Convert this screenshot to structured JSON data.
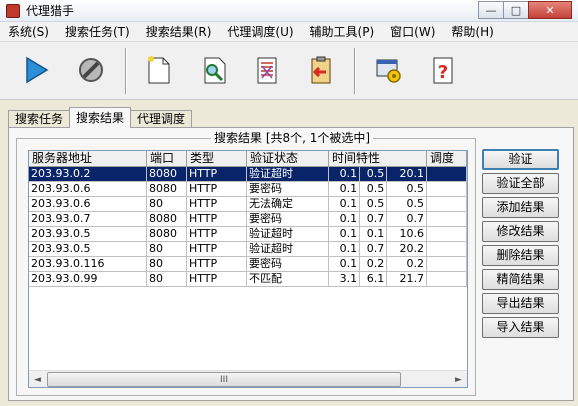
{
  "window": {
    "title": "代理猎手",
    "minimize": "—",
    "maximize": "□",
    "close": "✕"
  },
  "menu": [
    "系统(S)",
    "搜索任务(T)",
    "搜索结果(R)",
    "代理调度(U)",
    "辅助工具(P)",
    "窗口(W)",
    "帮助(H)"
  ],
  "toolbar": {
    "icons": [
      "play-icon",
      "stop-icon",
      "new-document-icon",
      "search-document-icon",
      "list-document-icon",
      "clipboard-import-icon",
      "settings-window-icon",
      "help-document-icon"
    ],
    "help_glyph": "?"
  },
  "tabs": [
    "搜索任务",
    "搜索结果",
    "代理调度"
  ],
  "group_title": "搜索结果 [共8个, 1个被选中]",
  "columns": [
    "服务器地址",
    "端口",
    "类型",
    "验证状态",
    "时间特性",
    "调度"
  ],
  "rows": [
    {
      "addr": "203.93.0.2",
      "port": "8080",
      "type": "HTTP",
      "status": "验证超时",
      "t1": "0.1",
      "t2": "0.5",
      "t3": "20.1",
      "sched": "",
      "selected": true
    },
    {
      "addr": "203.93.0.6",
      "port": "8080",
      "type": "HTTP",
      "status": "要密码",
      "t1": "0.1",
      "t2": "0.5",
      "t3": "0.5",
      "sched": ""
    },
    {
      "addr": "203.93.0.6",
      "port": "80",
      "type": "HTTP",
      "status": "无法确定",
      "t1": "0.1",
      "t2": "0.5",
      "t3": "0.5",
      "sched": ""
    },
    {
      "addr": "203.93.0.7",
      "port": "8080",
      "type": "HTTP",
      "status": "要密码",
      "t1": "0.1",
      "t2": "0.7",
      "t3": "0.7",
      "sched": ""
    },
    {
      "addr": "203.93.0.5",
      "port": "8080",
      "type": "HTTP",
      "status": "验证超时",
      "t1": "0.1",
      "t2": "0.1",
      "t3": "10.6",
      "sched": ""
    },
    {
      "addr": "203.93.0.5",
      "port": "80",
      "type": "HTTP",
      "status": "验证超时",
      "t1": "0.1",
      "t2": "0.7",
      "t3": "20.2",
      "sched": ""
    },
    {
      "addr": "203.93.0.116",
      "port": "80",
      "type": "HTTP",
      "status": "要密码",
      "t1": "0.1",
      "t2": "0.2",
      "t3": "0.2",
      "sched": ""
    },
    {
      "addr": "203.93.0.99",
      "port": "80",
      "type": "HTTP",
      "status": "不匹配",
      "t1": "3.1",
      "t2": "6.1",
      "t3": "21.7",
      "sched": ""
    }
  ],
  "scrollbar": {
    "left": "◄",
    "right": "►",
    "grip": "III"
  },
  "buttons": [
    "验证",
    "验证全部",
    "添加结果",
    "修改结果",
    "删除结果",
    "精简结果",
    "导出结果",
    "导入结果"
  ]
}
